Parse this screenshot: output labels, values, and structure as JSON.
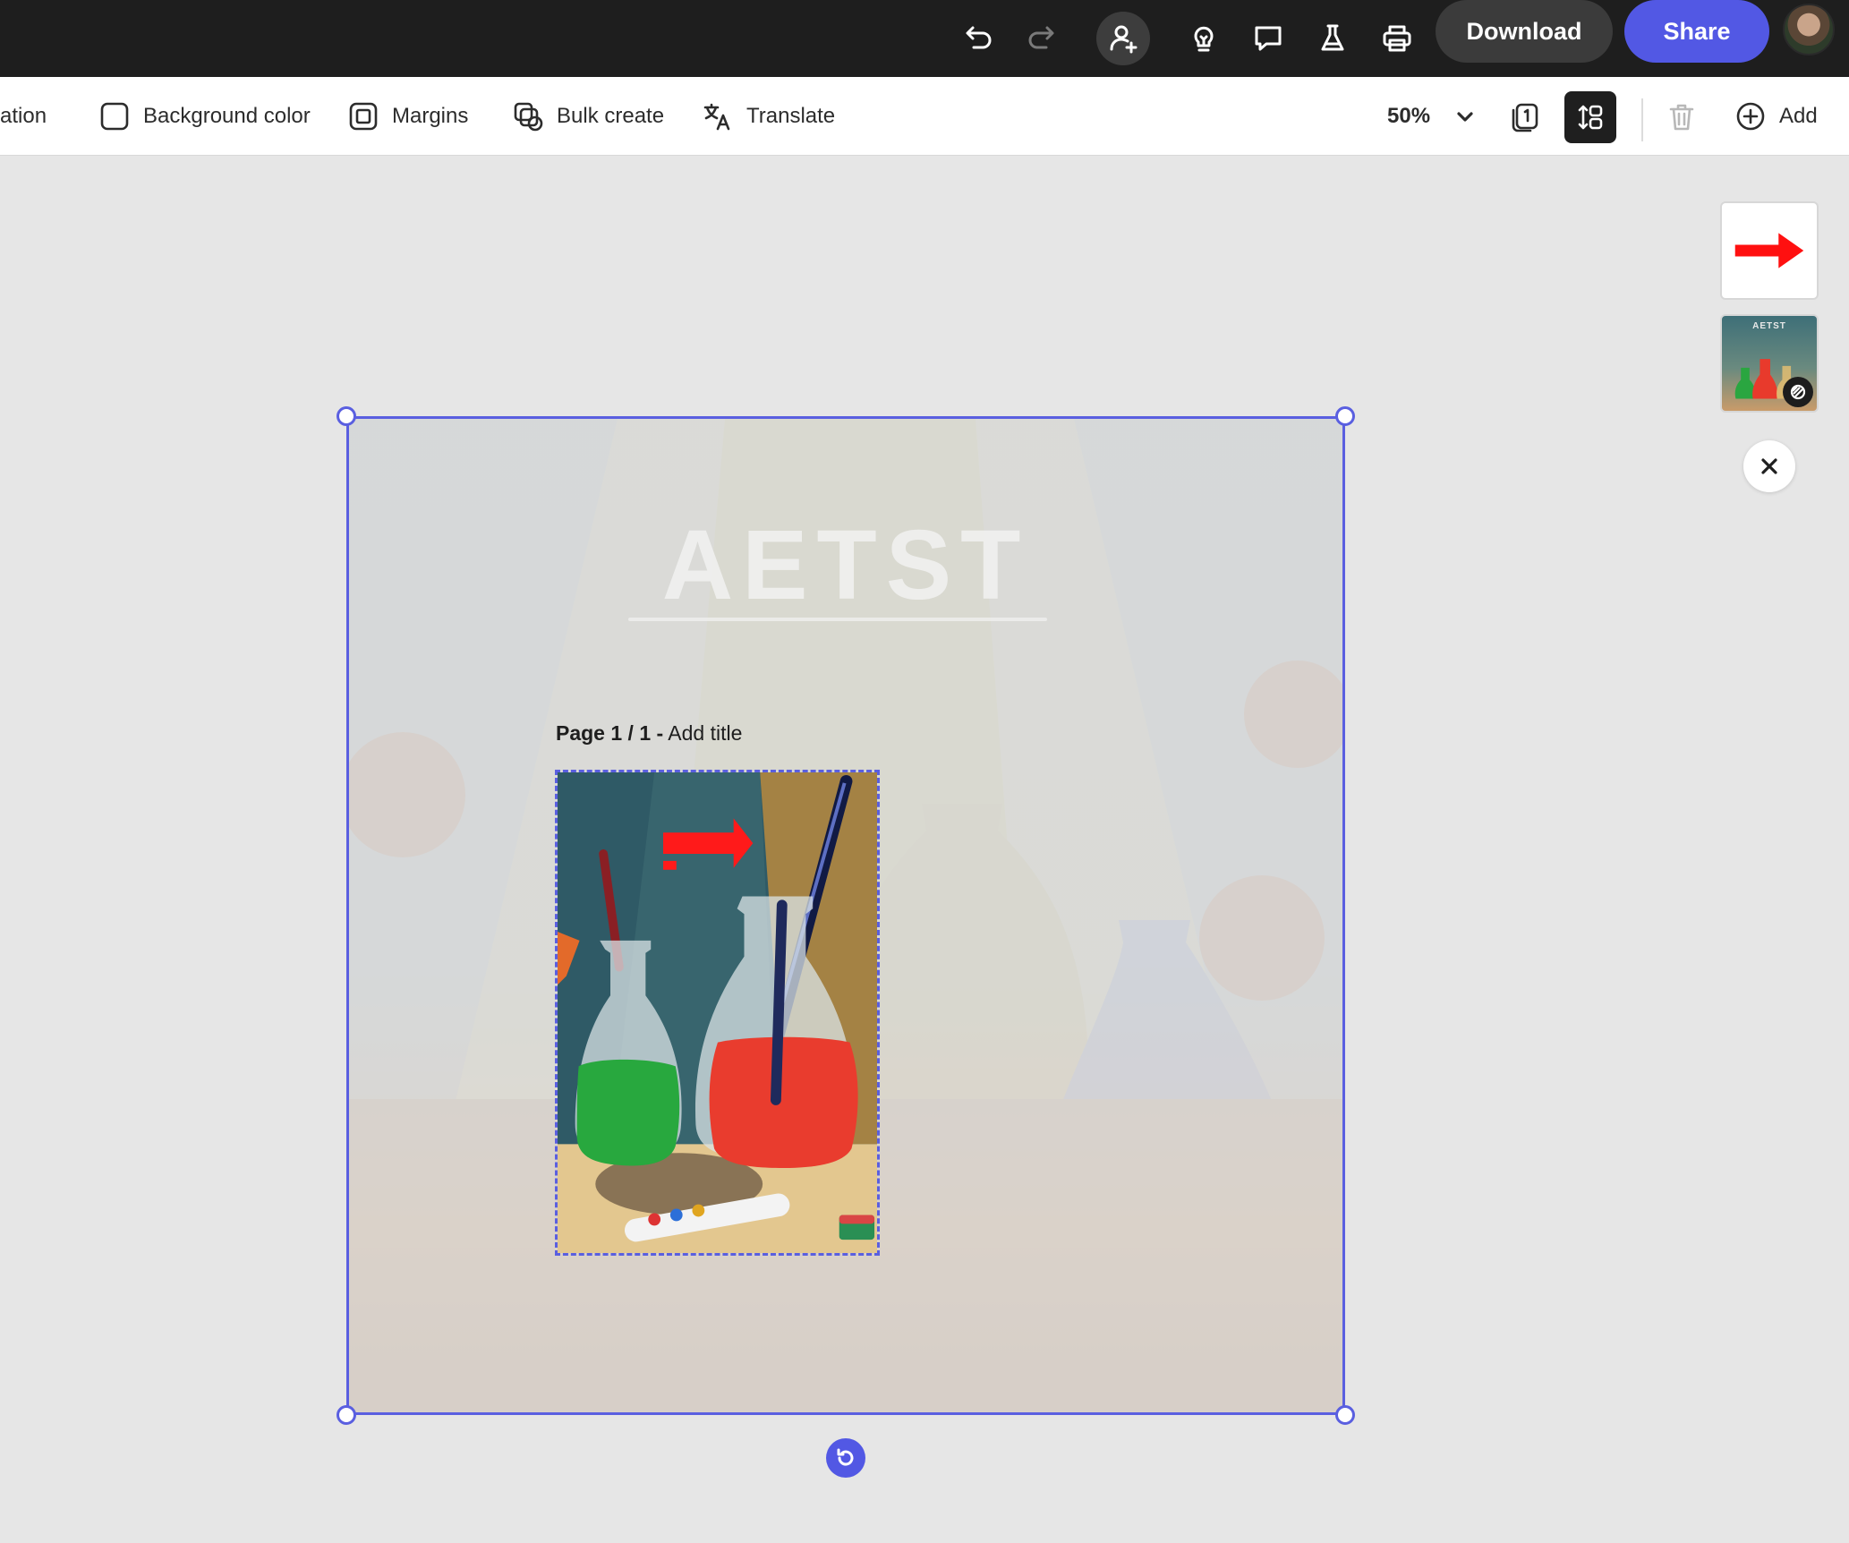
{
  "topbar": {
    "download_label": "Download",
    "share_label": "Share",
    "icons": [
      "undo-icon",
      "redo-icon",
      "invite-icon",
      "ideas-icon",
      "comment-icon",
      "flask-icon",
      "print-icon"
    ],
    "accent_color": "#5258e4"
  },
  "toolbar": {
    "animation_label": "ation",
    "background_color_label": "Background color",
    "margins_label": "Margins",
    "bulk_create_label": "Bulk create",
    "translate_label": "Translate",
    "zoom_value": "50%",
    "add_label": "Add"
  },
  "canvas": {
    "page_label_bold": "Page 1 / 1 -",
    "page_label_title": " Add title",
    "background_title": "AETST"
  },
  "thumbnails": {
    "thumb2_title": "AETST"
  }
}
